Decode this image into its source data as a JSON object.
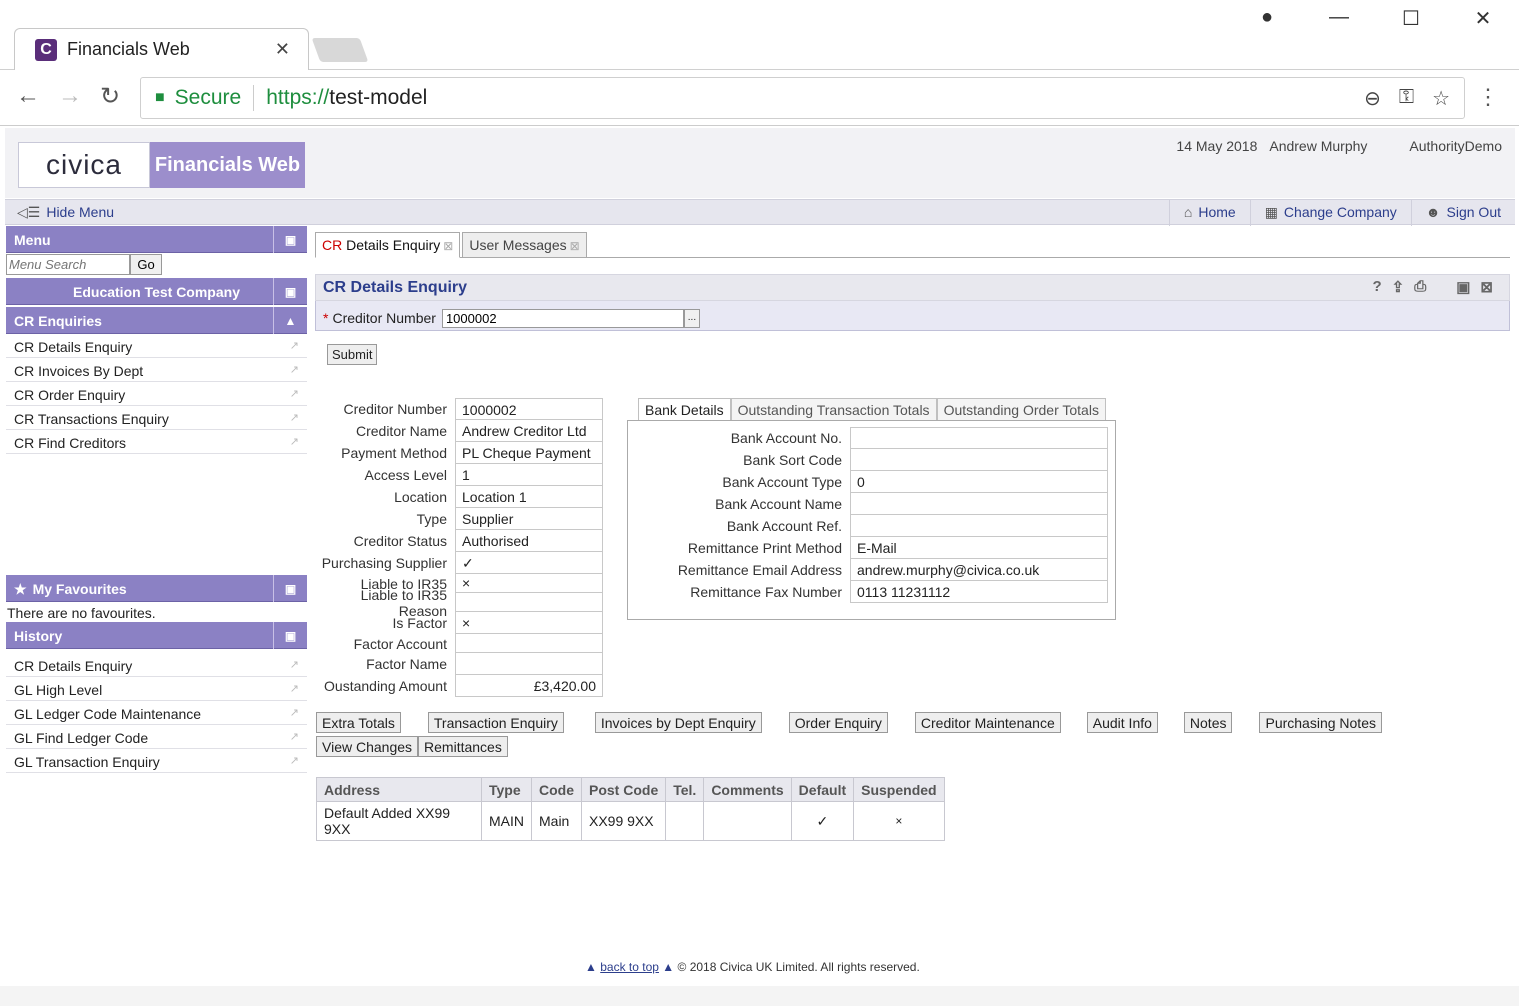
{
  "browser": {
    "tab_title": "Financials Web",
    "tab_icon_letter": "C",
    "secure_label": "Secure",
    "url_scheme": "https://",
    "url_host": "test-model"
  },
  "header": {
    "logo_text": "civica",
    "product": "Financials Web",
    "date": "14 May 2018",
    "user": "Andrew Murphy",
    "company": "AuthorityDemo"
  },
  "toolbar": {
    "hide_menu": "Hide Menu",
    "home": "Home",
    "change_company": "Change Company",
    "sign_out": "Sign Out"
  },
  "sidebar": {
    "menu_title": "Menu",
    "search_placeholder": "Menu Search",
    "go_label": "Go",
    "company_title": "Education Test Company",
    "section_title": "CR Enquiries",
    "items": [
      "CR Details Enquiry",
      "CR Invoices By Dept",
      "CR Order Enquiry",
      "CR Transactions Enquiry",
      "CR Find Creditors"
    ],
    "favourites_title": "My Favourites",
    "no_favourites": "There are no favourites.",
    "history_title": "History",
    "history": [
      "CR Details Enquiry",
      "GL High Level",
      "GL Ledger Code Maintenance",
      "GL Find Ledger Code",
      "GL Transaction Enquiry"
    ]
  },
  "main": {
    "tab1_prefix": "CR",
    "tab1_rest": " Details Enquiry",
    "tab2": "User Messages",
    "title": "CR Details Enquiry",
    "criteria_label": "Creditor Number",
    "criteria_value": "1000002",
    "submit_label": "Submit"
  },
  "details": [
    {
      "label": "Creditor Number",
      "value": "1000002"
    },
    {
      "label": "Creditor Name",
      "value": "Andrew Creditor Ltd"
    },
    {
      "label": "Payment Method",
      "value": "PL Cheque Payment"
    },
    {
      "label": "Access Level",
      "value": "1"
    },
    {
      "label": "Location",
      "value": "Location 1"
    },
    {
      "label": "Type",
      "value": "Supplier"
    },
    {
      "label": "Creditor Status",
      "value": "Authorised"
    },
    {
      "label": "Purchasing Supplier",
      "value": "✓"
    },
    {
      "label": "Liable to IR35",
      "value": "×"
    },
    {
      "label": "Liable to IR35 Reason",
      "value": ""
    },
    {
      "label": "Is Factor",
      "value": "×"
    },
    {
      "label": "Factor Account",
      "value": ""
    },
    {
      "label": "Factor Name",
      "value": ""
    },
    {
      "label": "Oustanding Amount",
      "value": "£3,420.00"
    }
  ],
  "bank": {
    "tabs": [
      "Bank Details",
      "Outstanding Transaction Totals",
      "Outstanding Order Totals"
    ],
    "rows": [
      {
        "label": "Bank Account No.",
        "value": ""
      },
      {
        "label": "Bank Sort Code",
        "value": ""
      },
      {
        "label": "Bank Account Type",
        "value": "0"
      },
      {
        "label": "Bank Account Name",
        "value": ""
      },
      {
        "label": "Bank Account Ref.",
        "value": ""
      },
      {
        "label": "Remittance Print Method",
        "value": "E-Mail"
      },
      {
        "label": "Remittance Email Address",
        "value": "andrew.murphy@civica.co.uk"
      },
      {
        "label": "Remittance Fax Number",
        "value": "0113 11231112"
      }
    ]
  },
  "actions": [
    "Extra Totals",
    "Transaction Enquiry",
    "Invoices by Dept Enquiry",
    "Order Enquiry",
    "Creditor Maintenance",
    "Audit Info",
    "Notes",
    "Purchasing Notes",
    "View Changes",
    "Remittances"
  ],
  "address_table": {
    "headers": [
      "Address",
      "Type",
      "Code",
      "Post Code",
      "Tel.",
      "Comments",
      "Default",
      "Suspended"
    ],
    "row": [
      "Default Added XX99 9XX",
      "MAIN",
      "Main",
      "XX99 9XX",
      "",
      "",
      "✓",
      "×"
    ]
  },
  "footer": {
    "back_to_top": "back to top",
    "copyright": "© 2018 Civica UK Limited. All rights reserved."
  }
}
